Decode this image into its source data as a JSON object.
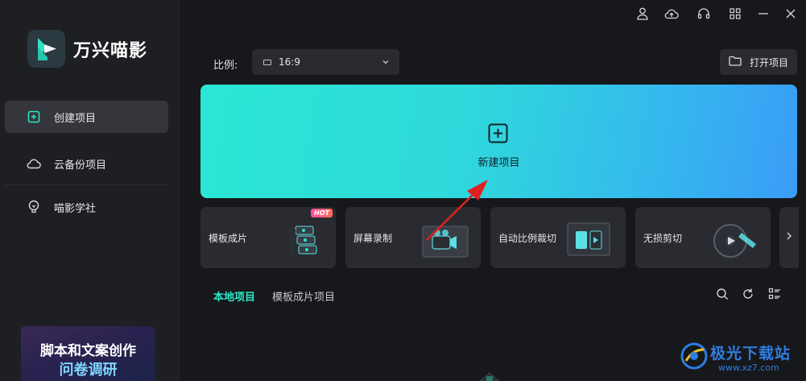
{
  "app": {
    "name": "万兴喵影"
  },
  "sidebar": {
    "items": [
      {
        "label": "创建项目",
        "icon": "add-project-icon",
        "active": true
      },
      {
        "label": "云备份项目",
        "icon": "cloud-icon",
        "active": false
      },
      {
        "label": "喵影学社",
        "icon": "lightbulb-icon",
        "active": false
      }
    ],
    "promo": {
      "line1": "脚本和文案创作",
      "line2": "问卷调研"
    }
  },
  "window_controls": [
    "user-icon",
    "cloud-upload-icon",
    "headset-icon",
    "grid-icon",
    "minimize-icon",
    "close-icon"
  ],
  "toolbar": {
    "ratio_label": "比例:",
    "ratio_value": "16:9",
    "open_label": "打开项目"
  },
  "hero": {
    "label": "新建项目"
  },
  "cards": [
    {
      "label": "模板成片",
      "badge": "HOT",
      "icon": "template-stack-icon"
    },
    {
      "label": "屏幕录制",
      "badge": "",
      "icon": "screen-record-icon"
    },
    {
      "label": "自动比例裁切",
      "badge": "",
      "icon": "auto-crop-icon"
    },
    {
      "label": "无损剪切",
      "badge": "",
      "icon": "film-reel-icon"
    }
  ],
  "tabs": [
    {
      "label": "本地项目",
      "active": true
    },
    {
      "label": "模板成片项目",
      "active": false
    }
  ],
  "watermark": {
    "text": "极光下载站",
    "url": "www.xz7.com"
  },
  "colors": {
    "accent": "#2ee6c6",
    "hero_start": "#2ae7d3",
    "hero_end": "#3a9cf7",
    "arrow": "#e02020"
  }
}
